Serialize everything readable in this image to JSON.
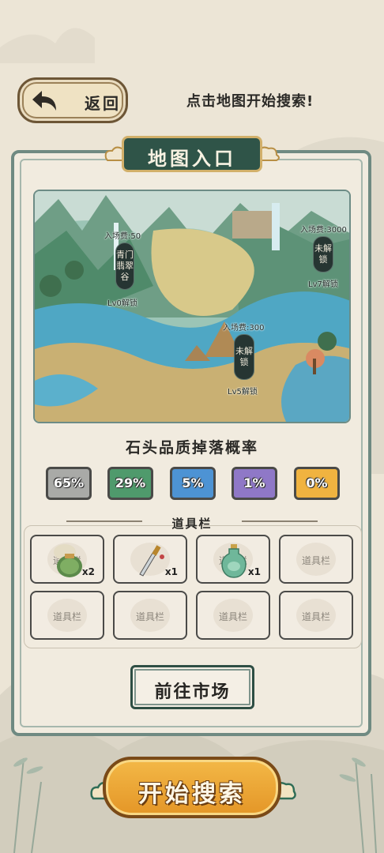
{
  "header": {
    "back_label": "返回",
    "hint": "点击地图开始搜索!"
  },
  "panel": {
    "title": "地图入口"
  },
  "map": {
    "locations": [
      {
        "fee": "入场费:50",
        "name": "青门翡翠谷",
        "unlock": "Lv0解锁"
      },
      {
        "fee": "入场费:3000",
        "name": "未解锁",
        "unlock": "Lv7解锁"
      },
      {
        "fee": "入场费:300",
        "name": "未解锁",
        "unlock": "Lv5解锁"
      }
    ]
  },
  "drop": {
    "title": "石头品质掉落概率",
    "rates": [
      {
        "label": "65%",
        "color": "#a9aaa7"
      },
      {
        "label": "29%",
        "color": "#4f9a6c"
      },
      {
        "label": "5%",
        "color": "#4d93d4"
      },
      {
        "label": "1%",
        "color": "#8f78c7"
      },
      {
        "label": "0%",
        "color": "#f0b340"
      }
    ]
  },
  "items": {
    "title": "道具栏",
    "slots": [
      {
        "icon": "herb-pot-icon",
        "placeholder": "道具栏",
        "count": "x2"
      },
      {
        "icon": "dagger-icon",
        "placeholder": "",
        "count": "x1"
      },
      {
        "icon": "jade-potion-icon",
        "placeholder": "道具栏",
        "count": "x1"
      },
      {
        "icon": "",
        "placeholder": "道具栏",
        "count": ""
      },
      {
        "icon": "",
        "placeholder": "道具栏",
        "count": ""
      },
      {
        "icon": "",
        "placeholder": "道具栏",
        "count": ""
      },
      {
        "icon": "",
        "placeholder": "道具栏",
        "count": ""
      },
      {
        "icon": "",
        "placeholder": "道具栏",
        "count": ""
      }
    ]
  },
  "market_button": "前往市场",
  "start_button": "开始搜索"
}
